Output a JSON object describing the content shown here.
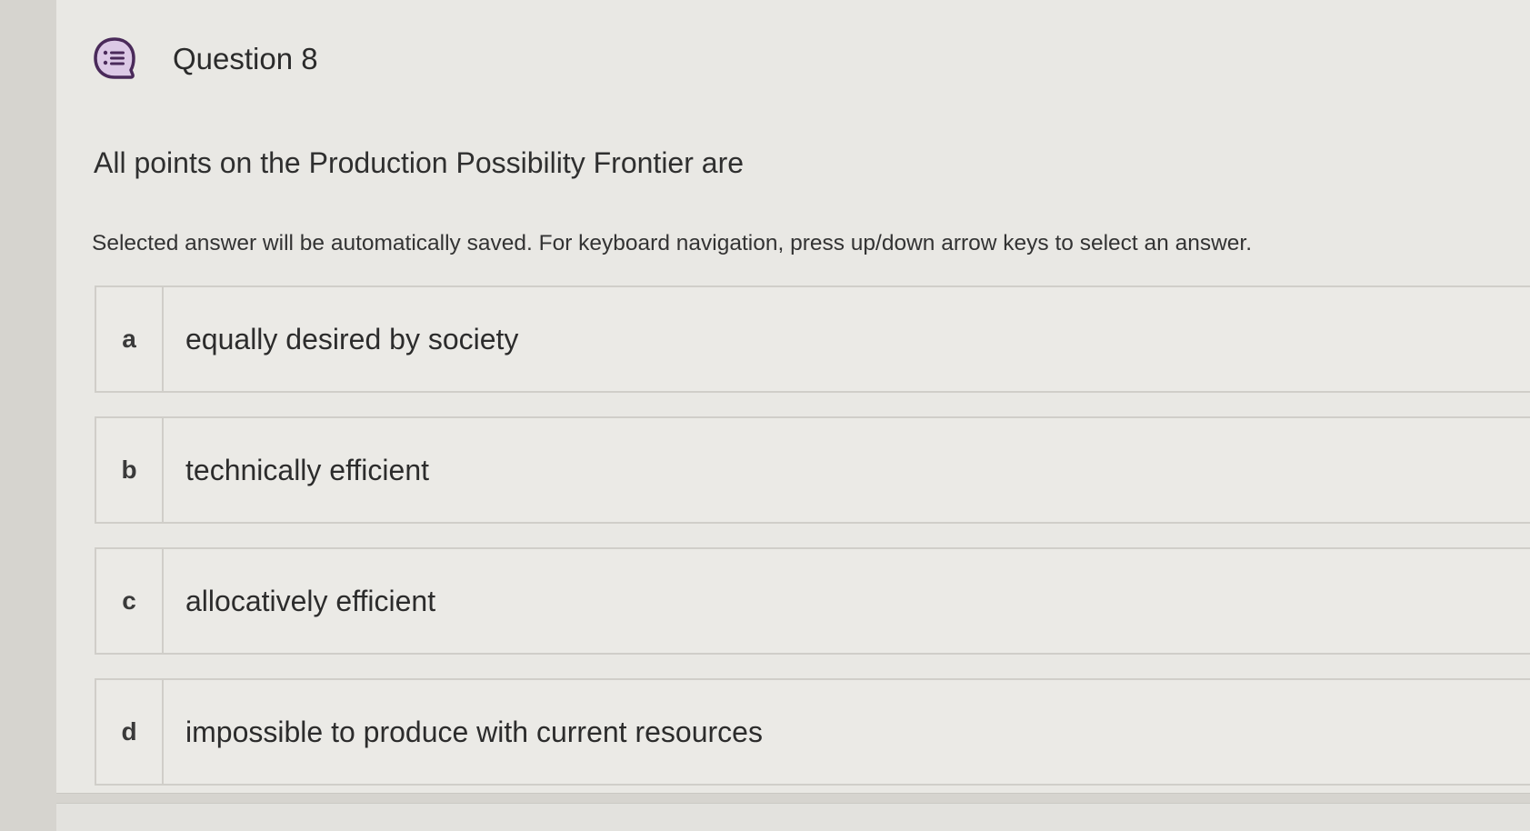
{
  "question": {
    "title": "Question 8",
    "icon": "multiple-choice-list-icon",
    "prompt": "All points on the Production Possibility Frontier are",
    "instruction": "Selected answer will be automatically saved. For keyboard navigation, press up/down arrow keys to select an answer."
  },
  "options": [
    {
      "letter": "a",
      "text": "equally desired by society"
    },
    {
      "letter": "b",
      "text": "technically efficient"
    },
    {
      "letter": "c",
      "text": "allocatively efficient"
    },
    {
      "letter": "d",
      "text": "impossible to produce with current resources"
    }
  ],
  "colors": {
    "icon_bg": "#dcc9e6",
    "icon_stroke": "#4a2a5a"
  }
}
